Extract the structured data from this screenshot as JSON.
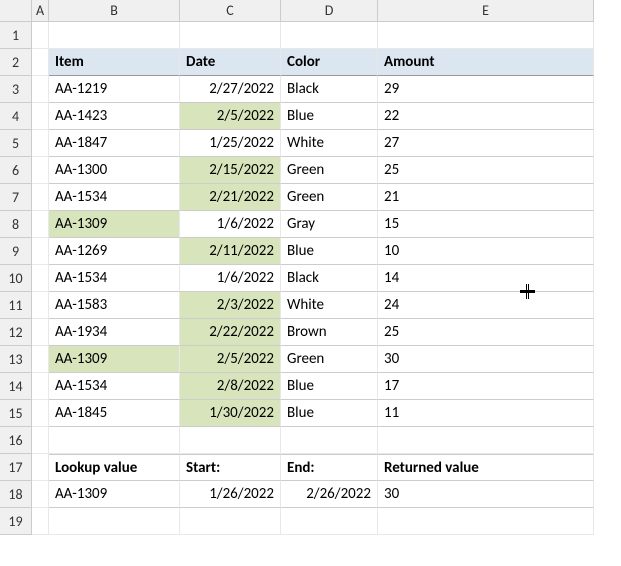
{
  "columns": [
    "A",
    "B",
    "C",
    "D",
    "E"
  ],
  "rows": [
    "1",
    "2",
    "3",
    "4",
    "5",
    "6",
    "7",
    "8",
    "9",
    "10",
    "11",
    "12",
    "13",
    "14",
    "15",
    "16",
    "17",
    "18",
    "19"
  ],
  "table1": {
    "headers": {
      "item": "Item",
      "date": "Date",
      "color": "Color",
      "amount": "Amount"
    },
    "data": [
      {
        "item": "AA-1219",
        "date": "2/27/2022",
        "color": "Black",
        "amount": "29",
        "hlItem": false,
        "hlDate": false
      },
      {
        "item": "AA-1423",
        "date": "2/5/2022",
        "color": "Blue",
        "amount": "22",
        "hlItem": false,
        "hlDate": true
      },
      {
        "item": "AA-1847",
        "date": "1/25/2022",
        "color": "White",
        "amount": "27",
        "hlItem": false,
        "hlDate": false
      },
      {
        "item": "AA-1300",
        "date": "2/15/2022",
        "color": "Green",
        "amount": "25",
        "hlItem": false,
        "hlDate": true
      },
      {
        "item": "AA-1534",
        "date": "2/21/2022",
        "color": "Green",
        "amount": "21",
        "hlItem": false,
        "hlDate": true
      },
      {
        "item": "AA-1309",
        "date": "1/6/2022",
        "color": "Gray",
        "amount": "15",
        "hlItem": true,
        "hlDate": false
      },
      {
        "item": "AA-1269",
        "date": "2/11/2022",
        "color": "Blue",
        "amount": "10",
        "hlItem": false,
        "hlDate": true
      },
      {
        "item": "AA-1534",
        "date": "1/6/2022",
        "color": "Black",
        "amount": "14",
        "hlItem": false,
        "hlDate": false
      },
      {
        "item": "AA-1583",
        "date": "2/3/2022",
        "color": "White",
        "amount": "24",
        "hlItem": false,
        "hlDate": true
      },
      {
        "item": "AA-1934",
        "date": "2/22/2022",
        "color": "Brown",
        "amount": "25",
        "hlItem": false,
        "hlDate": true
      },
      {
        "item": "AA-1309",
        "date": "2/5/2022",
        "color": "Green",
        "amount": "30",
        "hlItem": true,
        "hlDate": true
      },
      {
        "item": "AA-1534",
        "date": "2/8/2022",
        "color": "Blue",
        "amount": "17",
        "hlItem": false,
        "hlDate": true
      },
      {
        "item": "AA-1845",
        "date": "1/30/2022",
        "color": "Blue",
        "amount": "11",
        "hlItem": false,
        "hlDate": true
      }
    ]
  },
  "table2": {
    "headers": {
      "lookup": "Lookup value",
      "start": "Start:",
      "end": "End:",
      "ret": "Returned value"
    },
    "values": {
      "lookup": "AA-1309",
      "start": "1/26/2022",
      "end": "2/26/2022",
      "ret": "30"
    }
  },
  "chart_data": {
    "type": "table",
    "title": "",
    "columns": [
      "Item",
      "Date",
      "Color",
      "Amount"
    ],
    "rows": [
      [
        "AA-1219",
        "2/27/2022",
        "Black",
        29
      ],
      [
        "AA-1423",
        "2/5/2022",
        "Blue",
        22
      ],
      [
        "AA-1847",
        "1/25/2022",
        "White",
        27
      ],
      [
        "AA-1300",
        "2/15/2022",
        "Green",
        25
      ],
      [
        "AA-1534",
        "2/21/2022",
        "Green",
        21
      ],
      [
        "AA-1309",
        "1/6/2022",
        "Gray",
        15
      ],
      [
        "AA-1269",
        "2/11/2022",
        "Blue",
        10
      ],
      [
        "AA-1534",
        "1/6/2022",
        "Black",
        14
      ],
      [
        "AA-1583",
        "2/3/2022",
        "White",
        24
      ],
      [
        "AA-1934",
        "2/22/2022",
        "Brown",
        25
      ],
      [
        "AA-1309",
        "2/5/2022",
        "Green",
        30
      ],
      [
        "AA-1534",
        "2/8/2022",
        "Blue",
        17
      ],
      [
        "AA-1845",
        "1/30/2022",
        "Blue",
        11
      ]
    ],
    "lookup": {
      "Lookup value": "AA-1309",
      "Start": "1/26/2022",
      "End": "2/26/2022",
      "Returned value": 30
    }
  }
}
